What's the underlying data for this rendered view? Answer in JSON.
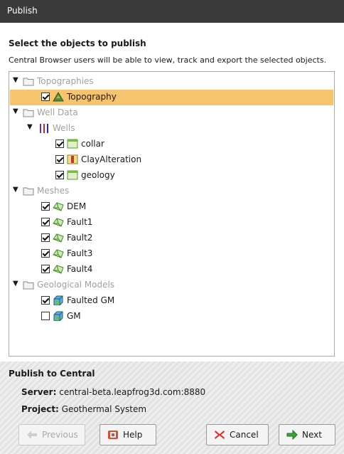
{
  "window": {
    "title": "Publish"
  },
  "heading": "Select the objects to publish",
  "description": "Central Browser users will be able to view, track and export the selected objects.",
  "tree": [
    {
      "label": "Topographies",
      "icon": "folder-icon",
      "kind": "folder"
    },
    {
      "label": "Topography",
      "icon": "topography-icon",
      "kind": "item",
      "checked": true,
      "selected": true
    },
    {
      "label": "Well Data",
      "icon": "folder-icon",
      "kind": "folder"
    },
    {
      "label": "Wells",
      "icon": "wells-icon",
      "kind": "subfolder"
    },
    {
      "label": "collar",
      "icon": "table-icon",
      "kind": "item",
      "checked": true
    },
    {
      "label": "ClayAlteration",
      "icon": "interval-table-icon",
      "kind": "item",
      "checked": true
    },
    {
      "label": "geology",
      "icon": "table-icon",
      "kind": "item",
      "checked": true
    },
    {
      "label": "Meshes",
      "icon": "folder-icon",
      "kind": "folder"
    },
    {
      "label": "DEM",
      "icon": "mesh-icon",
      "kind": "item",
      "checked": true
    },
    {
      "label": "Fault1",
      "icon": "mesh-icon",
      "kind": "item",
      "checked": true
    },
    {
      "label": "Fault2",
      "icon": "mesh-icon",
      "kind": "item",
      "checked": true
    },
    {
      "label": "Fault3",
      "icon": "mesh-icon",
      "kind": "item",
      "checked": true
    },
    {
      "label": "Fault4",
      "icon": "mesh-icon",
      "kind": "item",
      "checked": true
    },
    {
      "label": "Geological Models",
      "icon": "folder-icon",
      "kind": "folder"
    },
    {
      "label": "Faulted GM",
      "icon": "geological-model-icon",
      "kind": "item",
      "checked": true
    },
    {
      "label": "GM",
      "icon": "geological-model-icon",
      "kind": "item",
      "checked": false
    }
  ],
  "publish": {
    "title": "Publish to Central",
    "server_label": "Server:",
    "server_value": "central-beta.leapfrog3d.com:8880",
    "project_label": "Project:",
    "project_value": "Geothermal System"
  },
  "buttons": {
    "previous": "Previous",
    "help": "Help",
    "cancel": "Cancel",
    "next": "Next"
  }
}
